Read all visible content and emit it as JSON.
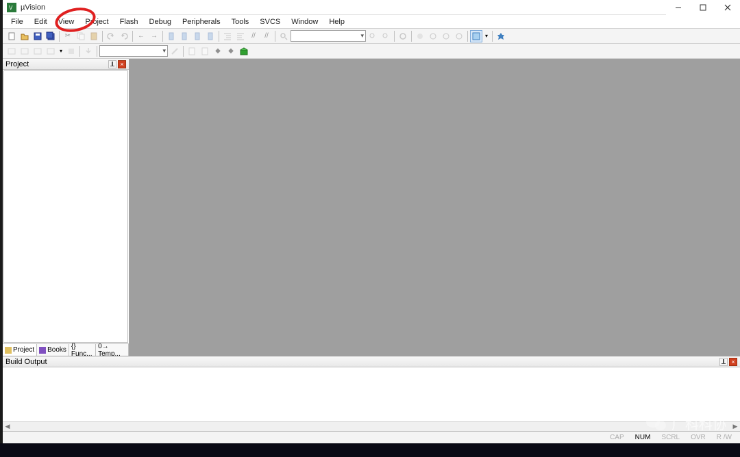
{
  "title": "µVision",
  "menu": [
    "File",
    "Edit",
    "View",
    "Project",
    "Flash",
    "Debug",
    "Peripherals",
    "Tools",
    "SVCS",
    "Window",
    "Help"
  ],
  "project_panel": {
    "title": "Project"
  },
  "panel_tabs": [
    {
      "label": "Project",
      "active": true
    },
    {
      "label": "Books",
      "active": false
    },
    {
      "label": "{} Func...",
      "active": false
    },
    {
      "label": "0→ Temp...",
      "active": false
    }
  ],
  "build_output": {
    "title": "Build Output"
  },
  "status": {
    "cap": "CAP",
    "num": "NUM",
    "scrl": "SCRL",
    "ovr": "OVR",
    "rw": "R /W"
  },
  "watermark": "广科科协"
}
